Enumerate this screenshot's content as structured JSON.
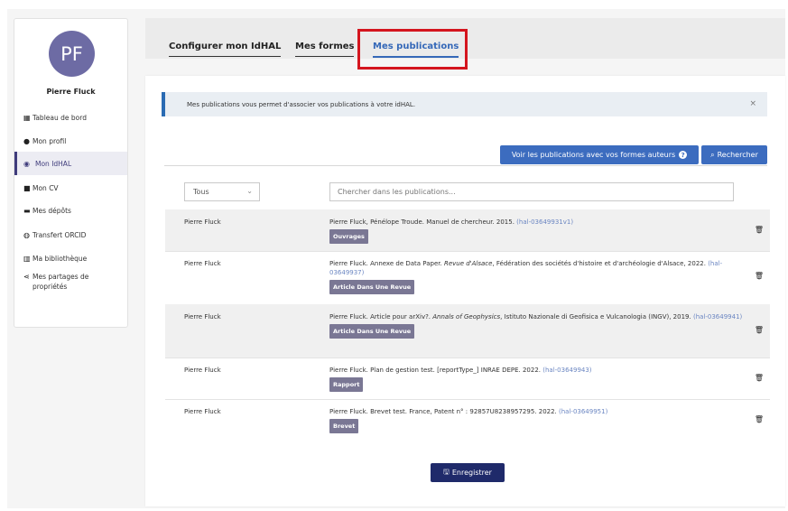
{
  "sidebar": {
    "avatar_initials": "PF",
    "user_name": "Pierre Fluck",
    "items": [
      {
        "label": "Tableau de bord",
        "icon": "dashboard-icon"
      },
      {
        "label": "Mon profil",
        "icon": "user-icon"
      },
      {
        "label": "Mon IdHAL",
        "icon": "idhal-icon"
      },
      {
        "label": "Mon CV",
        "icon": "cv-icon"
      },
      {
        "label": "Mes dépôts",
        "icon": "folder-icon"
      },
      {
        "label": "Transfert ORCID",
        "icon": "orcid-icon"
      },
      {
        "label": "Ma bibliothèque",
        "icon": "library-icon"
      },
      {
        "label": "Mes partages de propriétés",
        "icon": "share-icon"
      }
    ]
  },
  "tabs": {
    "configure": "Configurer mon IdHAL",
    "forms": "Mes formes",
    "publications": "Mes publications"
  },
  "banner": {
    "text": "Mes publications vous permet d'associer vos publications à votre idHAL.",
    "close": "×"
  },
  "actions": {
    "voir_label": "Voir les publications avec vos formes auteurs",
    "rechercher_label": "Rechercher"
  },
  "filter": {
    "selected": "Tous",
    "search_placeholder": "Chercher dans les publications..."
  },
  "publications": [
    {
      "author": "Pierre Fluck",
      "citation": "Pierre Fluck, Pénélope Troude. Manuel de chercheur. 2015.",
      "hal": "(hal-03649931v1)",
      "type": "Ouvrages"
    },
    {
      "author": "Pierre Fluck",
      "citation_pre": "Pierre Fluck. Annexe de Data Paper. ",
      "citation_journal": "Revue d'Alsace",
      "citation_post": ", Fédération des sociétés d'histoire et d'archéologie d'Alsace, 2022.",
      "hal": "(hal-03649937)",
      "type": "Article Dans Une Revue"
    },
    {
      "author": "Pierre Fluck",
      "citation_pre": "Pierre Fluck. Article pour arXiv?. ",
      "citation_journal": "Annals of Geophysics",
      "citation_post": ", Istituto Nazionale di Geofisica e Vulcanologia (INGV), 2019.",
      "hal": "(hal-03649941)",
      "type": "Article Dans Une Revue"
    },
    {
      "author": "Pierre Fluck",
      "citation": "Pierre Fluck. Plan de gestion test. [reportType_] INRAE DEPE. 2022.",
      "hal": "(hal-03649943)",
      "type": "Rapport"
    },
    {
      "author": "Pierre Fluck",
      "citation": "Pierre Fluck. Brevet test. France, Patent n° : 92857U8238957295. 2022.",
      "hal": "(hal-03649951)",
      "type": "Brevet"
    }
  ],
  "save_label": "Enregistrer",
  "colors": {
    "primary": "#3c6cbf",
    "dark_button": "#1f2a6a",
    "badge": "#7a7794",
    "highlight": "#d4151e",
    "avatar": "#6d6ba4"
  }
}
